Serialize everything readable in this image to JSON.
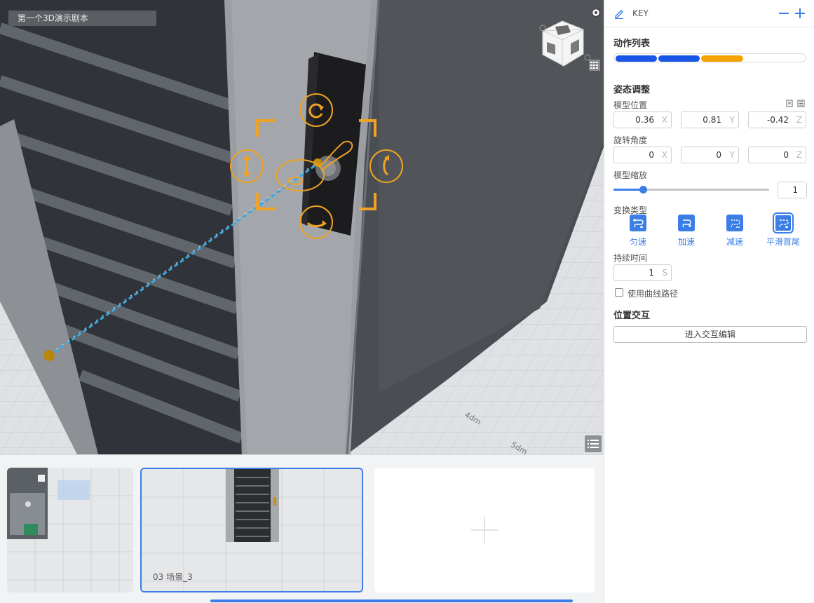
{
  "scene": {
    "title": "第一个3D演示剧本"
  },
  "viewport": {
    "axis_labels": [
      "4dm",
      "5dm"
    ]
  },
  "timeline": {
    "thumbnails": [
      {
        "label": ""
      },
      {
        "label": "03   场景_3",
        "selected": true
      },
      {
        "label": "",
        "is_add": true
      }
    ]
  },
  "panel": {
    "header": {
      "key_label": "KEY"
    },
    "action_list": {
      "title": "动作列表",
      "segments": [
        {
          "color": "#1a56e6"
        },
        {
          "color": "#1a56e6"
        },
        {
          "color": "#f5a300"
        }
      ]
    },
    "pose": {
      "title": "姿态调整",
      "position": {
        "label": "模型位置",
        "x": "0.36",
        "y": "0.81",
        "z": "-0.42"
      },
      "rotation": {
        "label": "旋转角度",
        "x": "0",
        "y": "0",
        "z": "0"
      },
      "scale": {
        "label": "模型缩放",
        "value": "1",
        "slider_fraction": 0.19
      },
      "axes": {
        "x": "X",
        "y": "Y",
        "z": "Z"
      }
    },
    "transition": {
      "label": "变换类型",
      "types": [
        {
          "label": "匀速",
          "selected": false
        },
        {
          "label": "加速",
          "selected": false
        },
        {
          "label": "减速",
          "selected": false
        },
        {
          "label": "平滑首尾",
          "selected": true
        }
      ]
    },
    "duration": {
      "label": "持续时间",
      "value": "1",
      "unit": "S"
    },
    "curve_path": {
      "label": "使用曲线路径",
      "checked": false
    },
    "interaction": {
      "title": "位置交互",
      "button": "进入交互编辑"
    }
  },
  "colors": {
    "accent": "#3a7ee6",
    "gizmo": "#f0a224",
    "path": "#3aa8e0"
  }
}
